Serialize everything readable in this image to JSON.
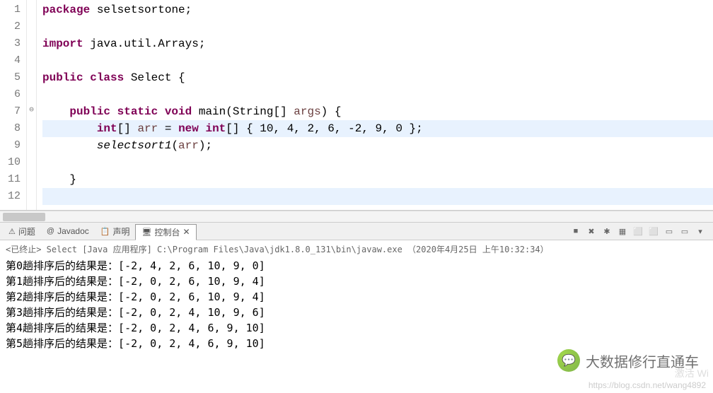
{
  "code": {
    "lines": [
      {
        "n": "1",
        "annot": "",
        "tokens": [
          {
            "t": "kw",
            "v": "package"
          },
          {
            "t": "sp",
            "v": " "
          },
          {
            "t": "ident",
            "v": "selsetsortone;"
          }
        ]
      },
      {
        "n": "2",
        "annot": "",
        "tokens": []
      },
      {
        "n": "3",
        "annot": "",
        "tokens": [
          {
            "t": "kw",
            "v": "import"
          },
          {
            "t": "sp",
            "v": " "
          },
          {
            "t": "ident",
            "v": "java.util.Arrays;"
          }
        ]
      },
      {
        "n": "4",
        "annot": "",
        "tokens": []
      },
      {
        "n": "5",
        "annot": "",
        "tokens": [
          {
            "t": "kw",
            "v": "public class"
          },
          {
            "t": "sp",
            "v": " "
          },
          {
            "t": "ident",
            "v": "Select {"
          }
        ]
      },
      {
        "n": "6",
        "annot": "",
        "tokens": []
      },
      {
        "n": "7",
        "annot": "⊖",
        "tokens": [
          {
            "t": "sp",
            "v": "    "
          },
          {
            "t": "kw",
            "v": "public static void"
          },
          {
            "t": "sp",
            "v": " "
          },
          {
            "t": "ident",
            "v": "main(String[] "
          },
          {
            "t": "param-name",
            "v": "args"
          },
          {
            "t": "ident",
            "v": ") {"
          }
        ]
      },
      {
        "n": "8",
        "annot": "",
        "hl": true,
        "tokens": [
          {
            "t": "sp",
            "v": "        "
          },
          {
            "t": "kw",
            "v": "int"
          },
          {
            "t": "ident",
            "v": "[] "
          },
          {
            "t": "var",
            "v": "arr"
          },
          {
            "t": "ident",
            "v": " = "
          },
          {
            "t": "kw",
            "v": "new int"
          },
          {
            "t": "ident",
            "v": "[] { 10, 4, 2, 6, -2, 9, 0 };"
          }
        ]
      },
      {
        "n": "9",
        "annot": "",
        "tokens": [
          {
            "t": "sp",
            "v": "        "
          },
          {
            "t": "call",
            "v": "selectsort1"
          },
          {
            "t": "ident",
            "v": "("
          },
          {
            "t": "var",
            "v": "arr"
          },
          {
            "t": "ident",
            "v": ");"
          }
        ]
      },
      {
        "n": "10",
        "annot": "",
        "tokens": []
      },
      {
        "n": "11",
        "annot": "",
        "tokens": [
          {
            "t": "sp",
            "v": "    "
          },
          {
            "t": "ident",
            "v": "}"
          }
        ]
      },
      {
        "n": "12",
        "annot": "",
        "hl": true,
        "tokens": []
      }
    ]
  },
  "tabs": {
    "items": [
      {
        "icon": "⚠",
        "label": "问题"
      },
      {
        "icon": "@",
        "label": "Javadoc"
      },
      {
        "icon": "📋",
        "label": "声明"
      },
      {
        "icon": "🖥",
        "label": "控制台"
      }
    ],
    "active_close": "✕"
  },
  "toolbar": {
    "icons": [
      "■",
      "✖",
      "✱",
      "▦",
      "⬜",
      "⬜",
      "▭",
      "▭",
      "▾"
    ]
  },
  "console": {
    "title": "<已终止> Select [Java 应用程序] C:\\Program Files\\Java\\jdk1.8.0_131\\bin\\javaw.exe （2020年4月25日 上午10:32:34）",
    "lines": [
      "第0趟排序后的结果是：[-2, 4, 2, 6, 10, 9, 0]",
      "第1趟排序后的结果是：[-2, 0, 2, 6, 10, 9, 4]",
      "第2趟排序后的结果是：[-2, 0, 2, 6, 10, 9, 4]",
      "第3趟排序后的结果是：[-2, 0, 2, 4, 10, 9, 6]",
      "第4趟排序后的结果是：[-2, 0, 2, 4, 6, 9, 10]",
      "第5趟排序后的结果是：[-2, 0, 2, 4, 6, 9, 10]"
    ]
  },
  "watermark": {
    "bubble_icon": "💬",
    "text": "大数据修行直通车",
    "url": "https://blog.csdn.net/wang4892",
    "activate": "激活 Wi"
  }
}
